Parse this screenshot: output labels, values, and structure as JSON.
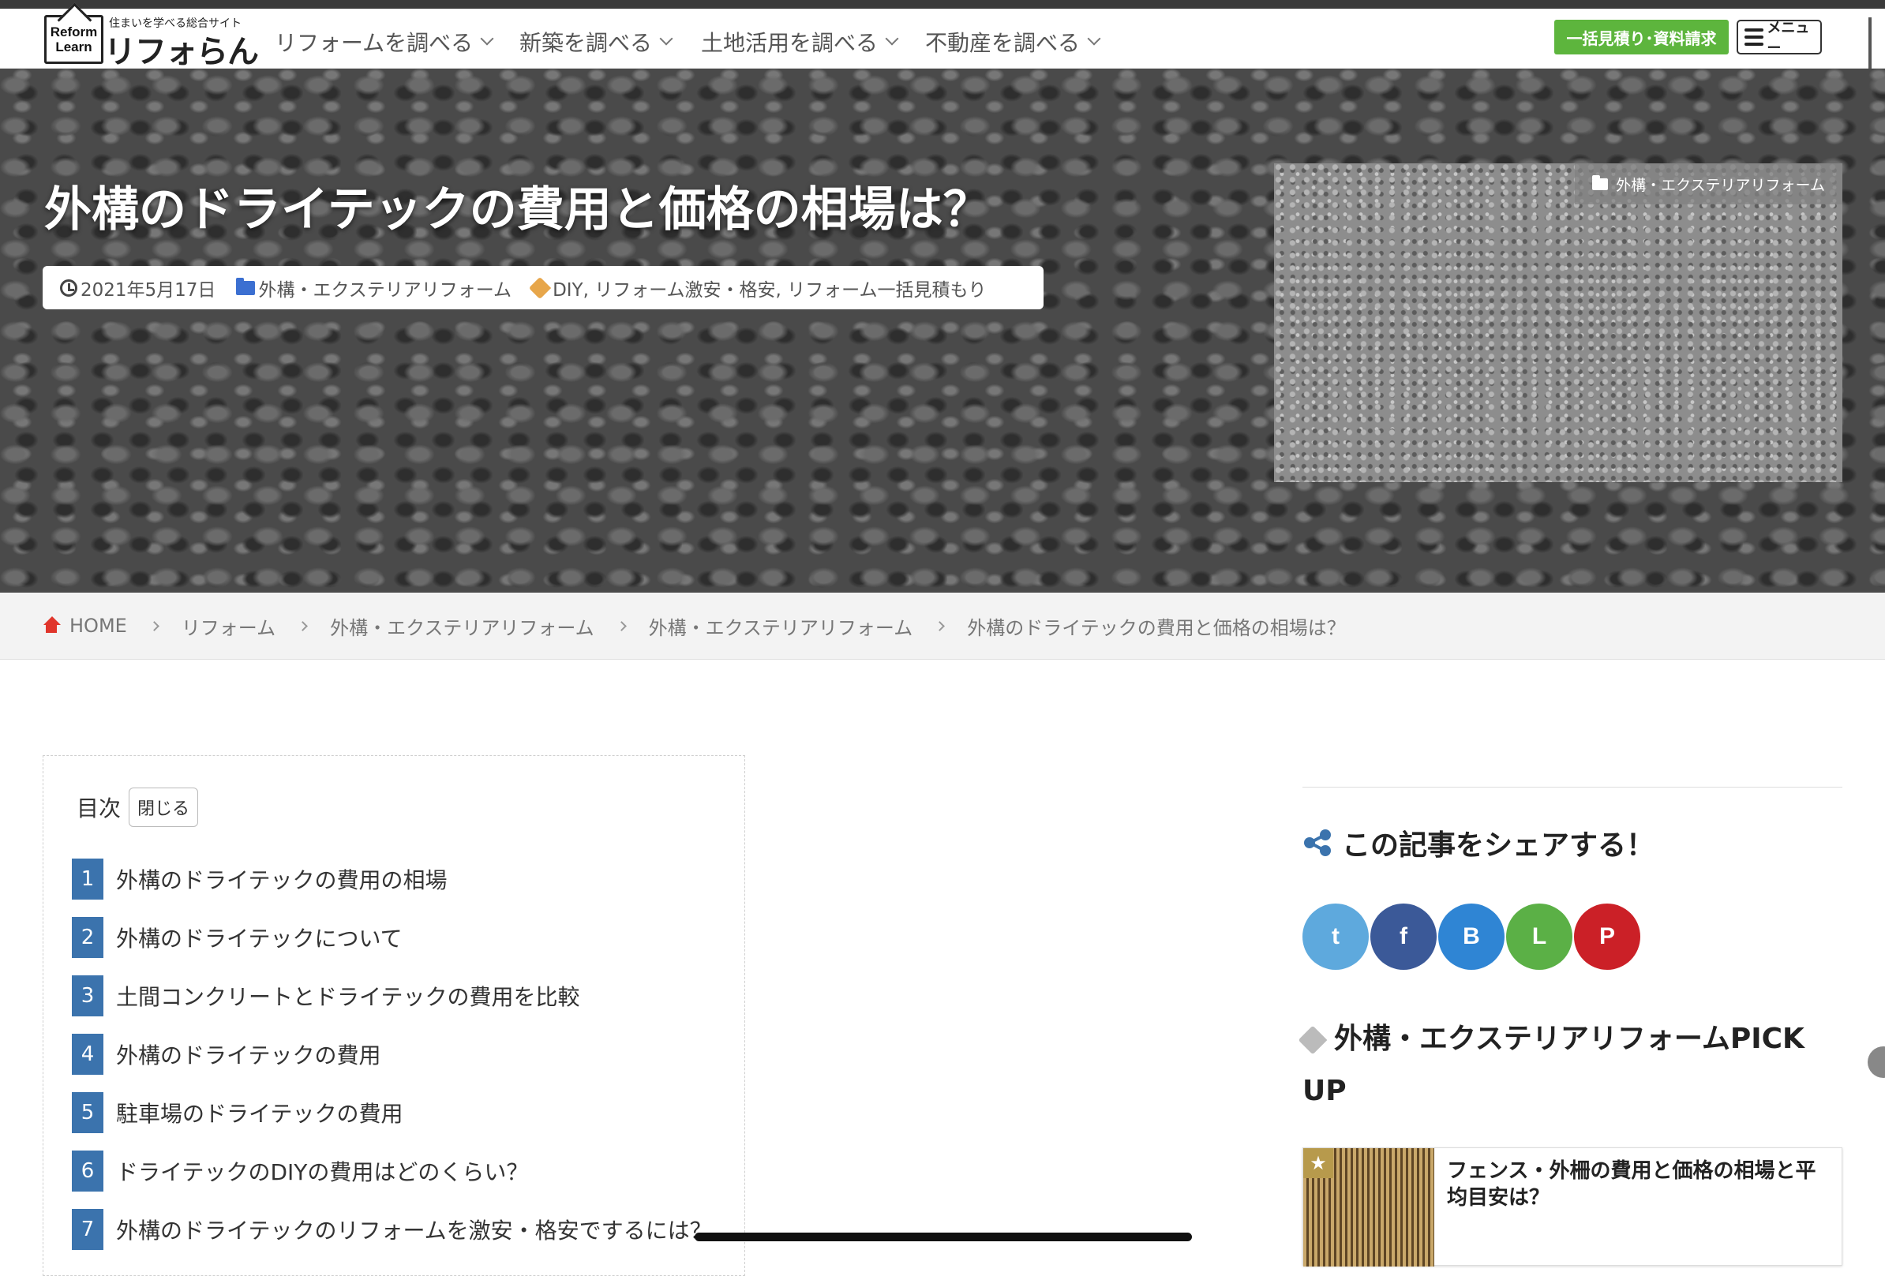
{
  "header": {
    "logo_line1": "Reform",
    "logo_line2": "Learn",
    "logo_tagline": "住まいを学べる総合サイト",
    "logo_name": "リフォらん",
    "nav": [
      "リフォームを調べる",
      "新築を調べる",
      "土地活用を調べる",
      "不動産を調べる"
    ],
    "cta_label": "一括見積り･資料請求",
    "menu_label": "メニュー"
  },
  "hero": {
    "title": "外構のドライテックの費用と価格の相場は？",
    "date": "2021年5月17日",
    "category": "外構・エクステリアリフォーム",
    "tags": "DIY, リフォーム激安・格安, リフォーム一括見積もり",
    "thumb_category": "外構・エクステリアリフォーム"
  },
  "breadcrumb": [
    "HOME",
    "リフォーム",
    "外構・エクステリアリフォーム",
    "外構・エクステリアリフォーム",
    "外構のドライテックの費用と価格の相場は？"
  ],
  "toc": {
    "title": "目次",
    "close_label": "閉じる",
    "items": [
      {
        "num": "1",
        "label": "外構のドライテックの費用の相場"
      },
      {
        "num": "2",
        "label": "外構のドライテックについて"
      },
      {
        "num": "3",
        "label": "土間コンクリートとドライテックの費用を比較"
      },
      {
        "num": "4",
        "label": "外構のドライテックの費用"
      },
      {
        "num": "5",
        "label": "駐車場のドライテックの費用"
      },
      {
        "num": "6",
        "label": "ドライテックのDIYの費用はどのくらい？"
      },
      {
        "num": "7",
        "label": "外構のドライテックのリフォームを激安・格安でするには？"
      }
    ]
  },
  "sidebar": {
    "share_title": "この記事をシェアする！",
    "share_buttons": [
      {
        "name": "twitter-icon",
        "glyph": "t",
        "color": "#5ea9dd"
      },
      {
        "name": "facebook-icon",
        "glyph": "f",
        "color": "#3b5998"
      },
      {
        "name": "blogger-icon",
        "glyph": "B",
        "color": "#2f85d4"
      },
      {
        "name": "line-icon",
        "glyph": "L",
        "color": "#5bb046"
      },
      {
        "name": "pinterest-icon",
        "glyph": "P",
        "color": "#cb2027"
      }
    ],
    "pickup_title": "外構・エクステリアリフォームPICK UP",
    "pickup_card_title": "フェンス・外柵の費用と価格の相場と平均目安は？",
    "star_glyph": "★"
  }
}
